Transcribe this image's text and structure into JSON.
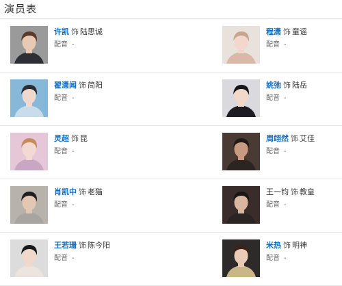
{
  "section": {
    "title": "演员表"
  },
  "cast": [
    {
      "actor": "许凯",
      "as": "饰",
      "role": "陆思诚",
      "voice_label": "配音",
      "voice_value": "-",
      "linked": true,
      "skin": "#e8c9b4",
      "hair": "#5a3b2a",
      "bg": "#9a9a9a",
      "shirt": "#2e2e35"
    },
    {
      "actor": "程潇",
      "as": "饰",
      "role": "童谣",
      "voice_label": "配音",
      "voice_value": "-",
      "linked": true,
      "skin": "#f3d6cc",
      "hair": "#c8a68e",
      "bg": "#e9e2dc",
      "shirt": "#d9b8a8"
    },
    {
      "actor": "翟潇闻",
      "as": "饰",
      "role": "简阳",
      "voice_label": "配音",
      "voice_value": "-",
      "linked": true,
      "skin": "#f0d9cc",
      "hair": "#2b2b30",
      "bg": "#87b8d8",
      "shirt": "#c9dcea"
    },
    {
      "actor": "姚弛",
      "as": "饰",
      "role": "陆岳",
      "voice_label": "配音",
      "voice_value": "-",
      "linked": true,
      "skin": "#f1d8c8",
      "hair": "#161616",
      "bg": "#d9d9de",
      "shirt": "#1c1c22"
    },
    {
      "actor": "灵超",
      "as": "饰",
      "role": "昆",
      "voice_label": "配音",
      "voice_value": "-",
      "linked": true,
      "skin": "#f4d9d2",
      "hair": "#c78a5e",
      "bg": "#e6c7d8",
      "shirt": "#c9a6c4"
    },
    {
      "actor": "周翊然",
      "as": "饰",
      "role": "艾佳",
      "voice_label": "配音",
      "voice_value": "-",
      "linked": true,
      "skin": "#c99a82",
      "hair": "#231a17",
      "bg": "#4a3a34",
      "shirt": "#2c2420"
    },
    {
      "actor": "肖凯中",
      "as": "饰",
      "role": "老猫",
      "voice_label": "配音",
      "voice_value": "-",
      "linked": true,
      "skin": "#e4c7b3",
      "hair": "#1f1f1f",
      "bg": "#b8b2ac",
      "shirt": "#a8a4a0"
    },
    {
      "actor": "王一钧",
      "as": "饰",
      "role": "教皇",
      "voice_label": "配音",
      "voice_value": "-",
      "linked": false,
      "skin": "#d8b6a0",
      "hair": "#1a1616",
      "bg": "#3a2c2a",
      "shirt": "#2a2424"
    },
    {
      "actor": "王若珊",
      "as": "饰",
      "role": "陈今阳",
      "voice_label": "配音",
      "voice_value": "-",
      "linked": true,
      "skin": "#f0d8ca",
      "hair": "#1a1a1a",
      "bg": "#dcdcdc",
      "shirt": "#ece4de"
    },
    {
      "actor": "米热",
      "as": "饰",
      "role": "明神",
      "voice_label": "配音",
      "voice_value": "-",
      "linked": true,
      "skin": "#e9cbb8",
      "hair": "#3a2418",
      "bg": "#2e2a2a",
      "shirt": "#c9b78a"
    }
  ]
}
